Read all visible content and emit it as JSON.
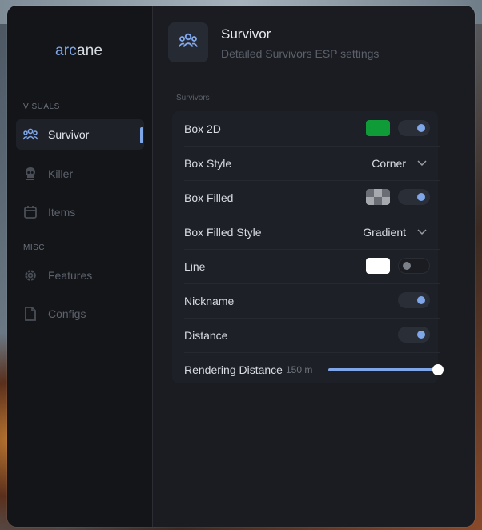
{
  "app": {
    "logo_prefix": "arc",
    "logo_suffix": "ane"
  },
  "sidebar": {
    "section_visuals": "VISUALS",
    "section_misc": "MISC",
    "items": [
      {
        "label": "Survivor",
        "icon": "users-icon",
        "active": true
      },
      {
        "label": "Killer",
        "icon": "skull-icon",
        "active": false
      },
      {
        "label": "Items",
        "icon": "calendar-icon",
        "active": false
      },
      {
        "label": "Features",
        "icon": "gear-icon",
        "active": false
      },
      {
        "label": "Configs",
        "icon": "file-icon",
        "active": false
      }
    ]
  },
  "header": {
    "title": "Survivor",
    "subtitle": "Detailed Survivors ESP settings",
    "icon": "users-icon"
  },
  "group": {
    "label": "Survivors",
    "rows": [
      {
        "label": "Box 2D",
        "color": "#0f9b38",
        "toggle": true
      },
      {
        "label": "Box Style",
        "dropdown": "Corner"
      },
      {
        "label": "Box Filled",
        "color": "checker",
        "toggle": true
      },
      {
        "label": "Box Filled Style",
        "dropdown": "Gradient"
      },
      {
        "label": "Line",
        "color": "#ffffff",
        "toggle": false
      },
      {
        "label": "Nickname",
        "toggle": true
      },
      {
        "label": "Distance",
        "toggle": true
      },
      {
        "label": "Rendering Distance",
        "slider_value": "150 m",
        "slider_fraction": 1.0
      }
    ]
  },
  "colors": {
    "accent": "#7fa6e8",
    "background": "#16181d",
    "panel": "#1d2026"
  }
}
